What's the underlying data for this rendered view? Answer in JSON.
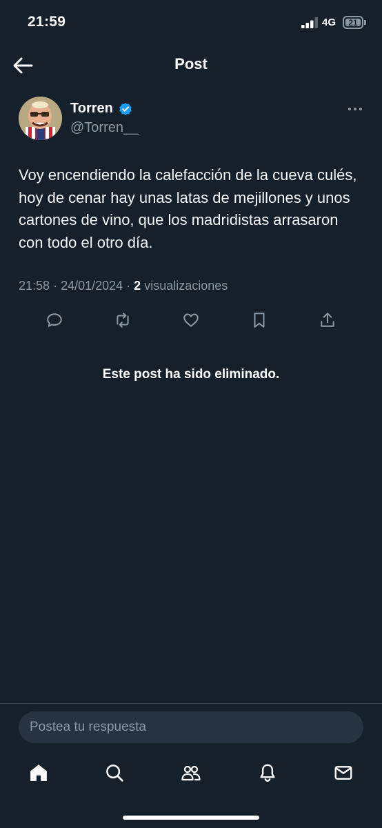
{
  "status_bar": {
    "time": "21:59",
    "network": "4G",
    "battery": "21"
  },
  "header": {
    "title": "Post",
    "back_icon": "arrow-left-icon"
  },
  "post": {
    "author_name": "Torren",
    "handle": "@Torren__",
    "verified": true,
    "text": "Voy encendiendo la calefacción de la cueva culés, hoy de cenar hay unas latas de mejillones y unos cartones de vino, que los madridistas arrasaron con todo el otro día.",
    "time": "21:58",
    "date": "24/01/2024",
    "views_count": "2",
    "views_label": "visualizaciones",
    "actions": [
      "reply-icon",
      "repost-icon",
      "like-icon",
      "bookmark-icon",
      "share-icon"
    ]
  },
  "deleted_notice": "Este post ha sido eliminado.",
  "reply": {
    "placeholder": "Postea tu respuesta"
  },
  "bottom_nav": [
    "home-icon",
    "search-icon",
    "communities-icon",
    "notifications-icon",
    "messages-icon"
  ],
  "colors": {
    "background": "#15202b",
    "muted": "#8b98a5",
    "verified": "#1d9bf0",
    "reply_box": "#273340"
  }
}
